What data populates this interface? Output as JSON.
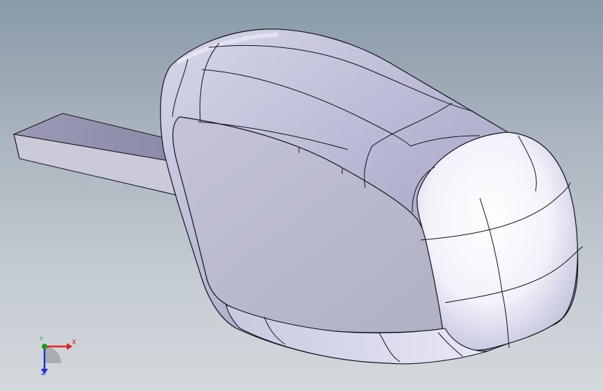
{
  "viewport": {
    "background_top": "#8a9aa8",
    "background_bottom": "#d3d8dc",
    "model_color": "#b8b8cc",
    "edge_color": "#101018"
  },
  "triad": {
    "x_label": "X",
    "y_label": "Y",
    "z_label": "Z",
    "x_color": "#e02020",
    "y_color": "#15a015",
    "z_color": "#2030d0"
  }
}
